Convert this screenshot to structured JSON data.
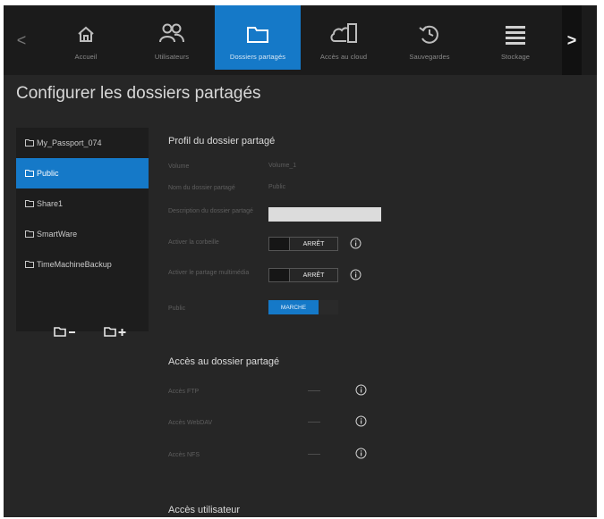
{
  "nav": {
    "items": [
      {
        "label": "Accueil",
        "icon": "home-icon"
      },
      {
        "label": "Utilisateurs",
        "icon": "users-icon"
      },
      {
        "label": "Dossiers partagés",
        "icon": "folder-icon"
      },
      {
        "label": "Accès au cloud",
        "icon": "cloud-device-icon"
      },
      {
        "label": "Sauvegardes",
        "icon": "backup-icon"
      },
      {
        "label": "Stockage",
        "icon": "storage-icon"
      }
    ],
    "active_index": 2,
    "prev_arrow": "<",
    "next_arrow": ">"
  },
  "page": {
    "title": "Configurer les dossiers partagés"
  },
  "shares": {
    "items": [
      {
        "label": "My_Passport_074"
      },
      {
        "label": "Public"
      },
      {
        "label": "Share1"
      },
      {
        "label": "SmartWare"
      },
      {
        "label": "TimeMachineBackup"
      }
    ],
    "selected_index": 1,
    "remove_icon": "folder-remove-icon",
    "add_icon": "folder-add-icon"
  },
  "profile": {
    "title": "Profil du dossier partagé",
    "volume_label": "Volume",
    "volume_value": "Volume_1",
    "name_label": "Nom du dossier partagé",
    "name_value": "Public",
    "description_label": "Description du dossier partagé",
    "description_value": "",
    "recycle_label": "Activer la corbeille",
    "recycle_state": "ARRÊT",
    "media_label": "Activer le partage multimédia",
    "media_state": "ARRÊT",
    "public_label": "Public",
    "public_state": "MARCHE"
  },
  "access": {
    "title": "Accès au dossier partagé",
    "ftp_label": "Accès FTP",
    "webdav_label": "Accès WebDAV",
    "nfs_label": "Accès NFS"
  },
  "user_access": {
    "title": "Accès utilisateur"
  },
  "colors": {
    "accent": "#1579c8",
    "background": "#262626",
    "nav_background": "#1b1b1b"
  }
}
